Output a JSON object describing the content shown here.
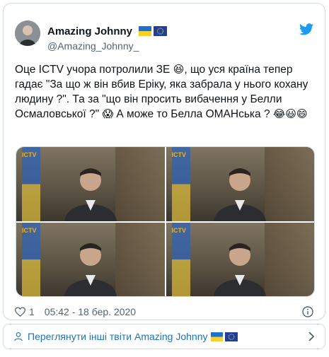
{
  "tweet": {
    "author_name": "Amazing Johnny",
    "author_handle": "@Amazing_Johnny_",
    "text_part1": "Оце ICTV учора потролили ЗЕ ",
    "emoji1": "😆",
    "text_part2": ", що уся країна тепер гадає \"За що ж він вбив Еріку, яка забрала у нього кохану людину ?\". Та за \"що він просить вибачення у Белли Осмаловської ?\" ",
    "emoji2": "😱",
    "text_part3": " А може то Белла ОМАНська ? ",
    "emoji3": "😂😃😄",
    "likes": "1",
    "timestamp": "05:42 - 18 бер. 2020"
  },
  "media": {
    "logo": "ICTV",
    "captions": [
      "",
      "",
      "",
      ""
    ]
  },
  "footer": {
    "link_label": "Переглянути інші твіти Amazing Johnny"
  },
  "colors": {
    "accent": "#1b74b8",
    "twitter_blue": "#1d9bf0",
    "muted": "#536471"
  },
  "icons": [
    "avatar",
    "ukraine-flag-icon",
    "eu-flag-icon",
    "twitter-bird-icon",
    "heart-icon",
    "info-icon",
    "user-icon",
    "chevron-right-icon"
  ]
}
